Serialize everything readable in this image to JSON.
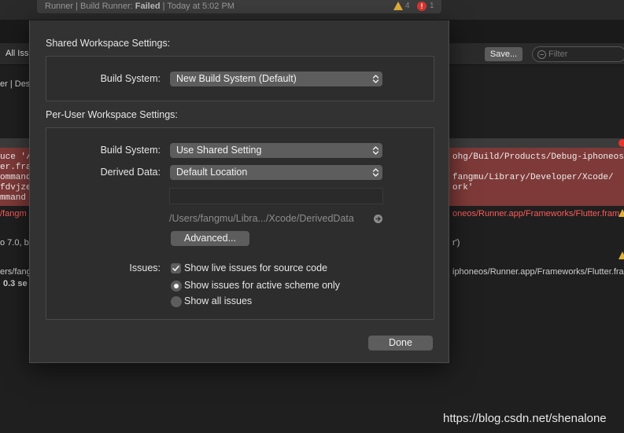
{
  "titlebar": {
    "prefix": "Runner | Build Runner: ",
    "state": "Failed",
    "suffix": " | Today at 5:02 PM",
    "warning_count": "4",
    "error_count": "1"
  },
  "background": {
    "filter_scope": "All Iss",
    "save_label": "Save...",
    "filter_placeholder": "Filter",
    "lines": {
      "l1": "er | Des",
      "l2": "uce '/",
      "l3": "er.fra",
      "l4": "ommand",
      "l5": "fdvjze",
      "l6": "mmand",
      "l7": "/fangm",
      "l8": "o 7.0, b",
      "l9": "ers/fang",
      "l10": "0.3 se",
      "r1": "ohg/Build/Products/Debug-iphoneos",
      "r2": "fangmu/Library/Developer/Xcode/",
      "r3": "ork'",
      "r4": "oneos/Runner.app/Frameworks/Flutter.fram",
      "r5": "r')",
      "r6": "iphoneos/Runner.app/Frameworks/Flutter.fra"
    }
  },
  "sheet": {
    "shared_title": "Shared Workspace Settings:",
    "shared_build_label": "Build System:",
    "shared_build_value": "New Build System (Default)",
    "peruser_title": "Per-User Workspace Settings:",
    "peruser_build_label": "Build System:",
    "peruser_build_value": "Use Shared Setting",
    "derived_label": "Derived Data:",
    "derived_value": "Default Location",
    "derived_path": "/Users/fangmu/Libra.../Xcode/DerivedData",
    "advanced_label": "Advanced...",
    "issues_label": "Issues:",
    "opt_live": "Show live issues for source code",
    "opt_active": "Show issues for active scheme only",
    "opt_all": "Show all issues",
    "done_label": "Done"
  },
  "watermark": "https://blog.csdn.net/shenalone",
  "colors": {
    "sheet_bg": "#323232",
    "control_bg": "#5d5d5d",
    "error_band": "#7e3a38",
    "error_text": "#ff5a5a",
    "warning": "#e0b03a"
  }
}
